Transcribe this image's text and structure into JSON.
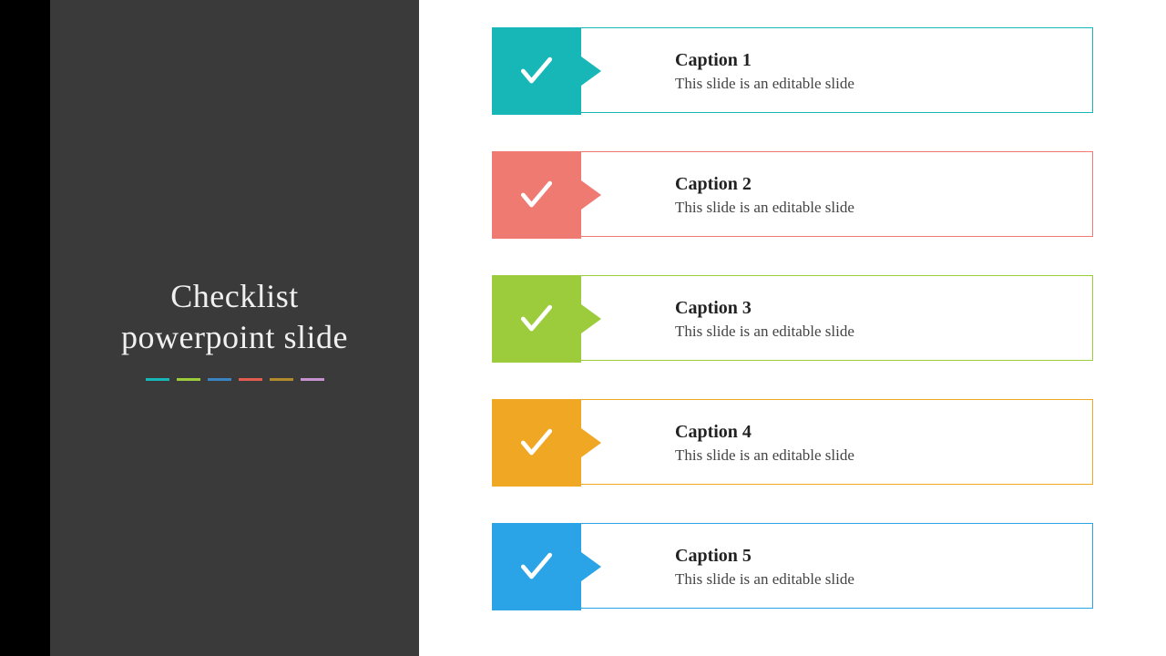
{
  "sidebar": {
    "title_line1": "Checklist",
    "title_line2": "powerpoint slide",
    "dash_colors": [
      "#18b7b7",
      "#9CCC3C",
      "#3b84c4",
      "#e25d4f",
      "#b38a2c",
      "#c792d0"
    ]
  },
  "items": [
    {
      "caption": "Caption 1",
      "subtitle": "This slide is an editable slide",
      "color": "#18b7b7"
    },
    {
      "caption": "Caption 2",
      "subtitle": "This slide is an editable slide",
      "color": "#ef7a72"
    },
    {
      "caption": "Caption 3",
      "subtitle": "This slide is an editable slide",
      "color": "#9CCC3C"
    },
    {
      "caption": "Caption 4",
      "subtitle": "This slide is an editable slide",
      "color": "#f0a724"
    },
    {
      "caption": "Caption 5",
      "subtitle": "This slide is an editable slide",
      "color": "#2aa4e6"
    }
  ]
}
